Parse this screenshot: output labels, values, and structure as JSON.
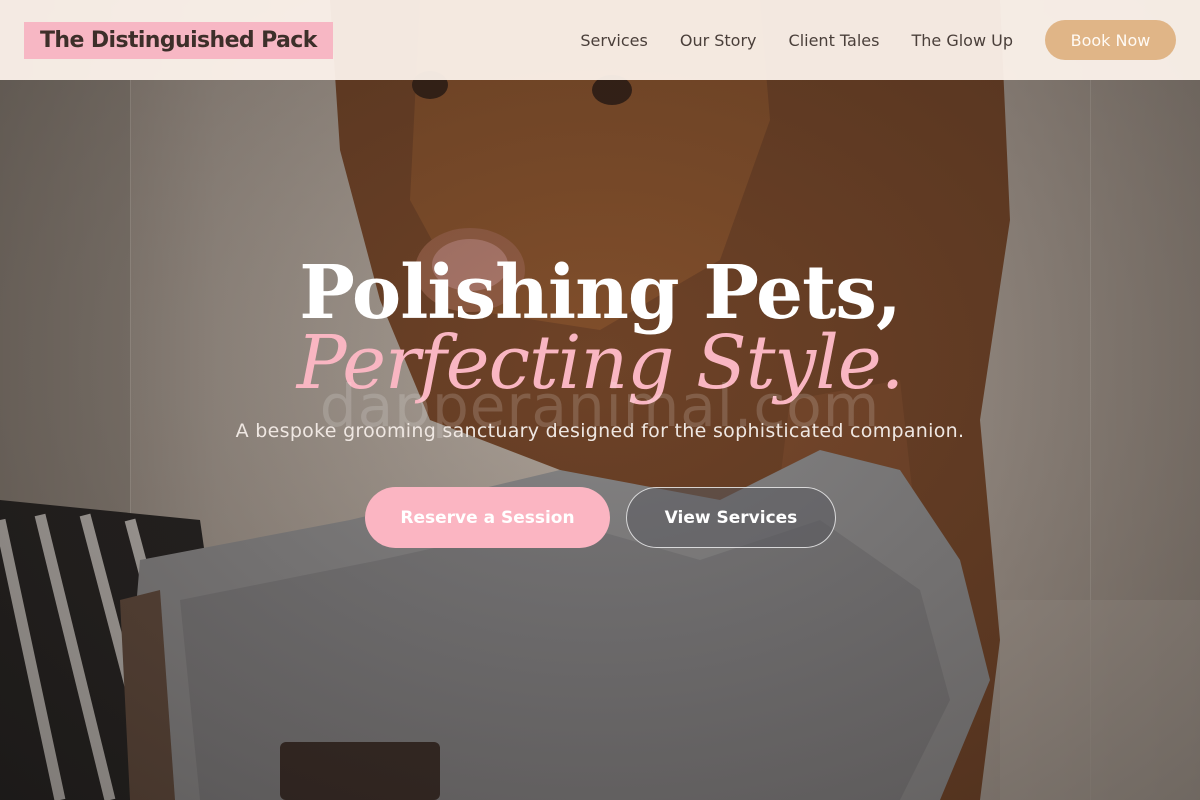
{
  "brand": {
    "name": "The Distinguished Pack"
  },
  "nav": {
    "links": [
      "Services",
      "Our Story",
      "Client Tales",
      "The Glow Up"
    ],
    "cta_label": "Book Now"
  },
  "hero": {
    "headline_line1": "Polishing Pets,",
    "headline_line2": "Perfecting Style.",
    "watermark": "dapperanimal.com",
    "tagline": "A bespoke grooming sanctuary designed for the sophisticated companion.",
    "primary_cta": "Reserve a Session",
    "secondary_cta": "View Services"
  },
  "colors": {
    "brand_highlight": "#f7b7c4",
    "accent_pink": "#f9b6c2",
    "book_button": "#e0b587",
    "nav_background": "#fdf3ec"
  }
}
